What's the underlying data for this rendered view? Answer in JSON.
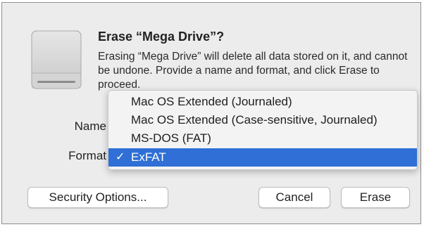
{
  "dialog": {
    "title": "Erase “Mega Drive”?",
    "description": "Erasing “Mega Drive” will delete all data stored on it, and cannot be undone. Provide a name and format, and click Erase to proceed."
  },
  "form": {
    "name_label": "Name",
    "format_label": "Format"
  },
  "format_menu": {
    "items": [
      {
        "label": "Mac OS Extended (Journaled)"
      },
      {
        "label": "Mac OS Extended (Case-sensitive, Journaled)"
      },
      {
        "label": "MS-DOS (FAT)"
      },
      {
        "label": "ExFAT"
      }
    ],
    "selected": "ExFAT",
    "checkmark": "✓"
  },
  "buttons": {
    "security_options": "Security Options...",
    "cancel": "Cancel",
    "erase": "Erase"
  },
  "icons": {
    "drive": "external-drive-icon"
  },
  "colors": {
    "selection": "#2f6fd6",
    "sheet_background": "#ececec"
  }
}
